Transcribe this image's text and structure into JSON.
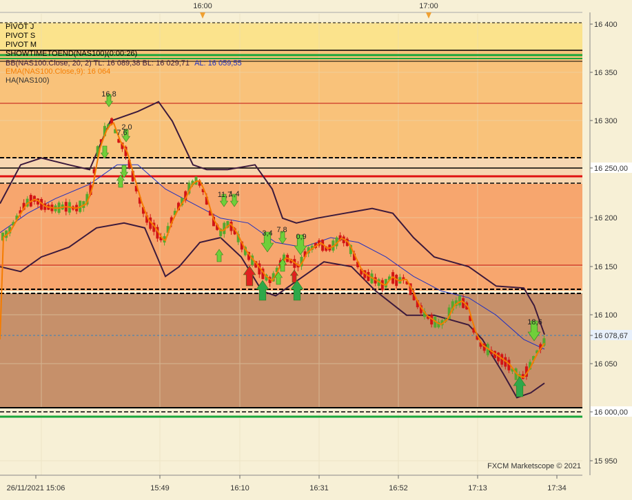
{
  "colors": {
    "background": "#f7f0d6",
    "zone_yellow": "#fbe38c",
    "zone_orange_light": "#f9c27a",
    "zone_orange": "#f7a66e",
    "zone_brown": "#c6906a",
    "bull": "#55a82e",
    "bear": "#d21414",
    "ema": "#f57c00",
    "bb": "#3c1a3c",
    "mid": "#2030c0",
    "pivot_red": "#e01010",
    "pivot_green": "#19a63a",
    "grid": "#d8d0b0"
  },
  "top_time_labels": [
    {
      "text": "16:00"
    },
    {
      "text": "17:00"
    }
  ],
  "indicators": {
    "pivot_j": "PIVOT J",
    "pivot_s": "PIVOT S",
    "pivot_m": "PIVOT M",
    "showtime": "SHOWTIMETOEND(NAS100)(0:00:26)",
    "bb": "BB(NAS100.Close, 20, 2)  TL: 16 089,38  BL: 16 029,71",
    "bb_al": "AL: 16 059,55",
    "ema": "EMA(NAS100.Close,9): 16 064",
    "ha": "HA(NAS100)"
  },
  "price_axis": [
    "16 400",
    "16 350",
    "16 300",
    "16 250,00",
    "16 200",
    "16 150",
    "16 100",
    "16 078,67",
    "16 050",
    "16 000,00",
    "15 950"
  ],
  "time_axis": [
    "26/11/2021 15:06",
    "15:49",
    "16:10",
    "16:31",
    "16:52",
    "17:13",
    "17:34"
  ],
  "signal_labels": [
    "16,8",
    "2,0",
    "7,6",
    "11,7",
    "1,4",
    "3,4",
    "7,8",
    "0,9",
    "18,6"
  ],
  "copyright": "FXCM Marketscope © 2021",
  "chart_data": {
    "type": "candlestick",
    "symbol": "NAS100",
    "ylim": [
      15940,
      16405
    ],
    "last_price": 16078.67,
    "pivot_levels": [
      16250,
      16000
    ],
    "bb_top": 16089.38,
    "bb_bottom": 16029.71,
    "bb_mid": 16059.55,
    "ema": 16064
  }
}
